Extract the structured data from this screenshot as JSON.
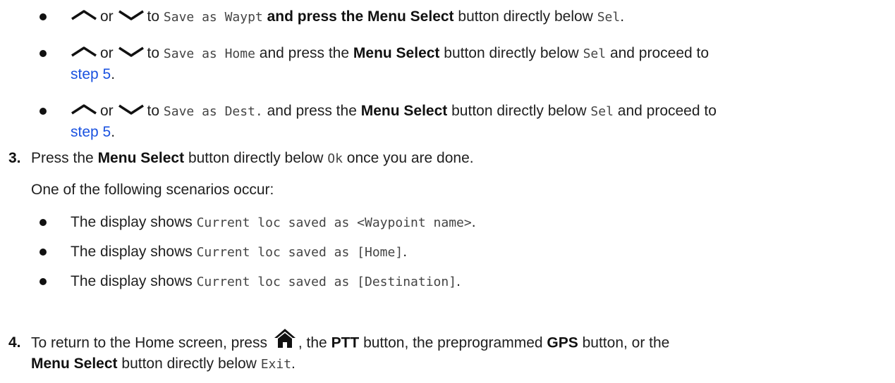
{
  "colors": {
    "link": "#1a52e0",
    "text": "#1f1f1f"
  },
  "icons": {
    "up": "chevron-up-icon",
    "down": "chevron-down-icon",
    "home": "home-icon"
  },
  "opt1": {
    "or": "or",
    "to": "to",
    "mono1": "Save as Waypt",
    "t1": "and press the",
    "b1": "Menu Select",
    "t2": "button directly below",
    "mono2": "Sel",
    "end": "."
  },
  "opt2": {
    "or": "or",
    "to": "to",
    "mono1": "Save as Home",
    "t1": "and press the",
    "b1": "Menu Select",
    "t2": "button directly below",
    "mono2": "Sel",
    "t3": "and proceed to",
    "link": "step 5",
    "end": "."
  },
  "opt3": {
    "or": "or",
    "to": "to",
    "mono1": "Save as Dest.",
    "t1": "and press the",
    "b1": "Menu Select",
    "t2": "button directly below",
    "mono2": "Sel",
    "t3": "and proceed to",
    "link": "step 5",
    "end": "."
  },
  "step3": {
    "num": "3.",
    "t1": "Press the",
    "b1": "Menu Select",
    "t2": "button directly below",
    "mono": "Ok",
    "t3": "once you are done.",
    "scenario_intro": "One of the following scenarios occur:"
  },
  "scenarios": [
    {
      "text": "The display shows",
      "mono": "Current loc saved as <Waypoint name>",
      "end": "."
    },
    {
      "text": "The display shows",
      "mono": "Current loc saved as [Home]",
      "end": "."
    },
    {
      "text": "The display shows",
      "mono": "Current loc saved as [Destination]",
      "end": "."
    }
  ],
  "step4": {
    "num": "4.",
    "t1": "To return to the Home screen, press",
    "t2": ", the",
    "b1": "PTT",
    "t3": "button, the preprogrammed",
    "b2": "GPS",
    "t4": "button, or the",
    "b3": "Menu Select",
    "t5": "button directly below",
    "mono": "Exit",
    "end": "."
  }
}
